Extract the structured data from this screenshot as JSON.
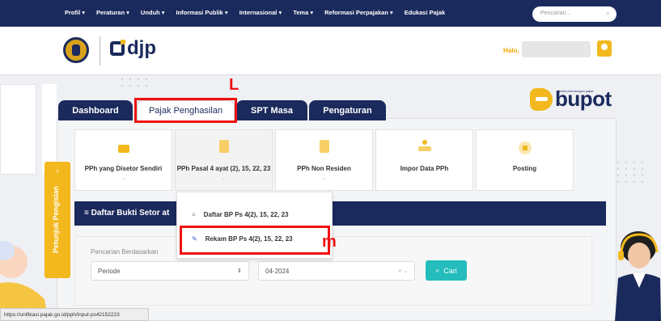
{
  "topnav": {
    "menu": [
      "Profil ▾",
      "Peraturan ▾",
      "Unduh ▾",
      "Informasi Publik ▾",
      "Internasional ▾",
      "Tema ▾",
      "Reformasi Perpajakan ▾",
      "Edukasi Pajak"
    ],
    "search_placeholder": "Pencarian..."
  },
  "header": {
    "logo_text": "djp",
    "greeting": "Halo,"
  },
  "brand": {
    "ebupot": "bupot",
    "ebupot_tagline": "bukti pemotongan pajak"
  },
  "tabs": [
    "Dashboard",
    "Pajak Penghasilan",
    "SPT Masa",
    "Pengaturan"
  ],
  "annotations": {
    "tab_marker": "L",
    "menu_marker": "m"
  },
  "cards": [
    {
      "label": "PPh yang Disetor Sendiri",
      "chevron": "⌄"
    },
    {
      "label": "PPh Pasal 4 ayat (2), 15, 22, 23",
      "chevron": "⌄"
    },
    {
      "label": "PPh Non Residen",
      "chevron": "⌄"
    },
    {
      "label": "Impor Data PPh",
      "chevron": ""
    },
    {
      "label": "Posting",
      "chevron": ""
    }
  ],
  "side_tab": {
    "label": "Petunjuk Pengisian",
    "arrow": "›"
  },
  "section_title": "≡  Daftar Bukti Setor at",
  "dropdown": [
    {
      "icon": "≡",
      "label": "Daftar BP Ps 4(2), 15, 22, 23"
    },
    {
      "icon": "✎",
      "label": "Rekam BP Ps 4(2), 15, 22, 23"
    }
  ],
  "search": {
    "label": "Pencarian Berdasarkan",
    "filter_value": "Periode",
    "filter_caret": "⇕",
    "period_value": "04-2024",
    "period_controls": "× ⌄",
    "button_label": "Cari",
    "button_icon": "🔍"
  },
  "status_url": "https://unifikasi.pajak.go.id/pph/input-ps42152223",
  "colors": {
    "navy": "#1b2a5c",
    "gold": "#f2b81d",
    "teal": "#24bcbc",
    "annotation": "#e11111"
  }
}
